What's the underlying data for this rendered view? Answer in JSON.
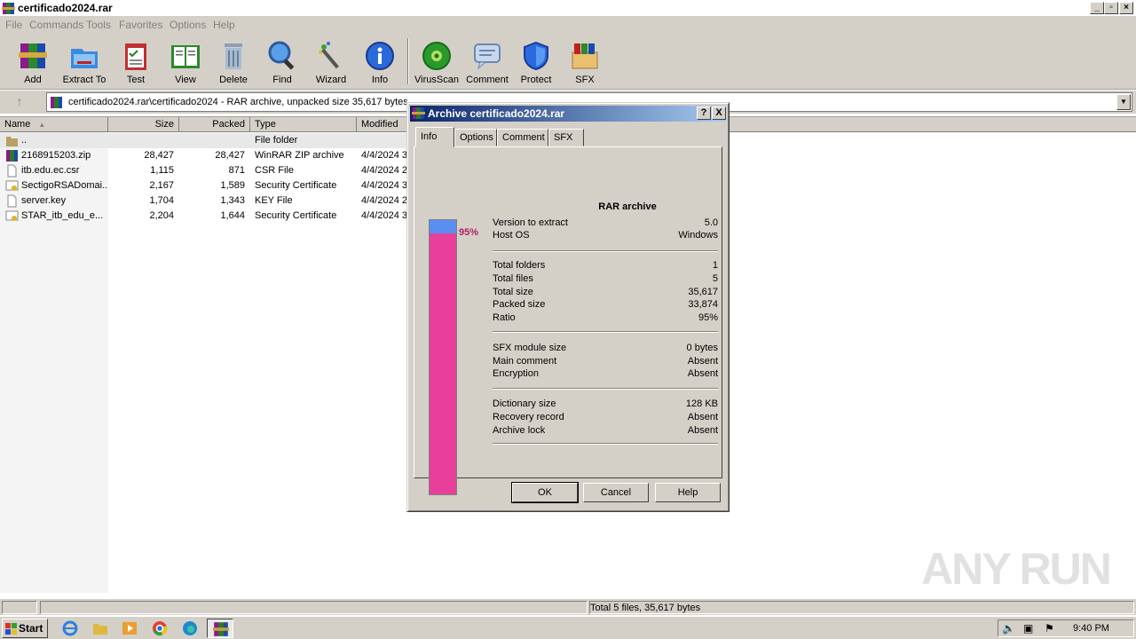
{
  "window": {
    "title": "certificado2024.rar"
  },
  "menu": [
    "File",
    "Commands",
    "Tools",
    "Favorites",
    "Options",
    "Help"
  ],
  "toolbar": [
    {
      "label": "Add",
      "icon": "add-archive-icon"
    },
    {
      "label": "Extract To",
      "icon": "extract-folder-icon"
    },
    {
      "label": "Test",
      "icon": "test-clipboard-icon"
    },
    {
      "label": "View",
      "icon": "view-book-icon"
    },
    {
      "label": "Delete",
      "icon": "trash-icon"
    },
    {
      "label": "Find",
      "icon": "magnifier-icon"
    },
    {
      "label": "Wizard",
      "icon": "magic-wand-icon"
    },
    {
      "label": "Info",
      "icon": "info-icon"
    },
    {
      "label": "VirusScan",
      "icon": "virus-scan-icon"
    },
    {
      "label": "Comment",
      "icon": "comment-icon"
    },
    {
      "label": "Protect",
      "icon": "shield-icon"
    },
    {
      "label": "SFX",
      "icon": "sfx-box-icon"
    }
  ],
  "address": {
    "path": "certificado2024.rar\\certificado2024 - RAR archive, unpacked size 35,617 bytes"
  },
  "columns": [
    "Name",
    "Size",
    "Packed",
    "Type",
    "Modified"
  ],
  "files": [
    {
      "name": "..",
      "size": "",
      "packed": "",
      "type": "File folder",
      "modified": "",
      "icon": "folder-icon"
    },
    {
      "name": "2168915203.zip",
      "size": "28,427",
      "packed": "28,427",
      "type": "WinRAR ZIP archive",
      "modified": "4/4/2024 3",
      "icon": "zip-archive-icon"
    },
    {
      "name": "itb.edu.ec.csr",
      "size": "1,115",
      "packed": "871",
      "type": "CSR File",
      "modified": "4/4/2024 2",
      "icon": "file-icon"
    },
    {
      "name": "SectigoRSADomai...",
      "size": "2,167",
      "packed": "1,589",
      "type": "Security Certificate",
      "modified": "4/4/2024 3",
      "icon": "certificate-icon"
    },
    {
      "name": "server.key",
      "size": "1,704",
      "packed": "1,343",
      "type": "KEY File",
      "modified": "4/4/2024 2",
      "icon": "file-icon"
    },
    {
      "name": "STAR_itb_edu_e...",
      "size": "2,204",
      "packed": "1,644",
      "type": "Security Certificate",
      "modified": "4/4/2024 3",
      "icon": "certificate-icon"
    }
  ],
  "status": {
    "total": "Total 5 files, 35,617 bytes"
  },
  "taskbar": {
    "start": "Start",
    "clock": "9:40 PM"
  },
  "watermark": "ANY RUN",
  "dialog": {
    "title": "Archive certificado2024.rar",
    "help_btn": "?",
    "close_btn": "X",
    "tabs": [
      "Info",
      "Options",
      "Comment",
      "SFX"
    ],
    "heading": "RAR archive",
    "ratio_percent": "95%",
    "ratio_value": 0.95,
    "groups": [
      [
        {
          "k": "Version to extract",
          "v": "5.0"
        },
        {
          "k": "Host OS",
          "v": "Windows"
        }
      ],
      [
        {
          "k": "Total folders",
          "v": "1"
        },
        {
          "k": "Total files",
          "v": "5"
        },
        {
          "k": "Total size",
          "v": "35,617"
        },
        {
          "k": "Packed size",
          "v": "33,874"
        },
        {
          "k": "Ratio",
          "v": "95%"
        }
      ],
      [
        {
          "k": "SFX module size",
          "v": "0 bytes"
        },
        {
          "k": "Main comment",
          "v": "Absent"
        },
        {
          "k": "Encryption",
          "v": "Absent"
        }
      ],
      [
        {
          "k": "Dictionary size",
          "v": "128 KB"
        },
        {
          "k": "Recovery record",
          "v": "Absent"
        },
        {
          "k": "Archive lock",
          "v": "Absent"
        }
      ]
    ],
    "buttons": {
      "ok": "OK",
      "cancel": "Cancel",
      "help": "Help"
    }
  }
}
